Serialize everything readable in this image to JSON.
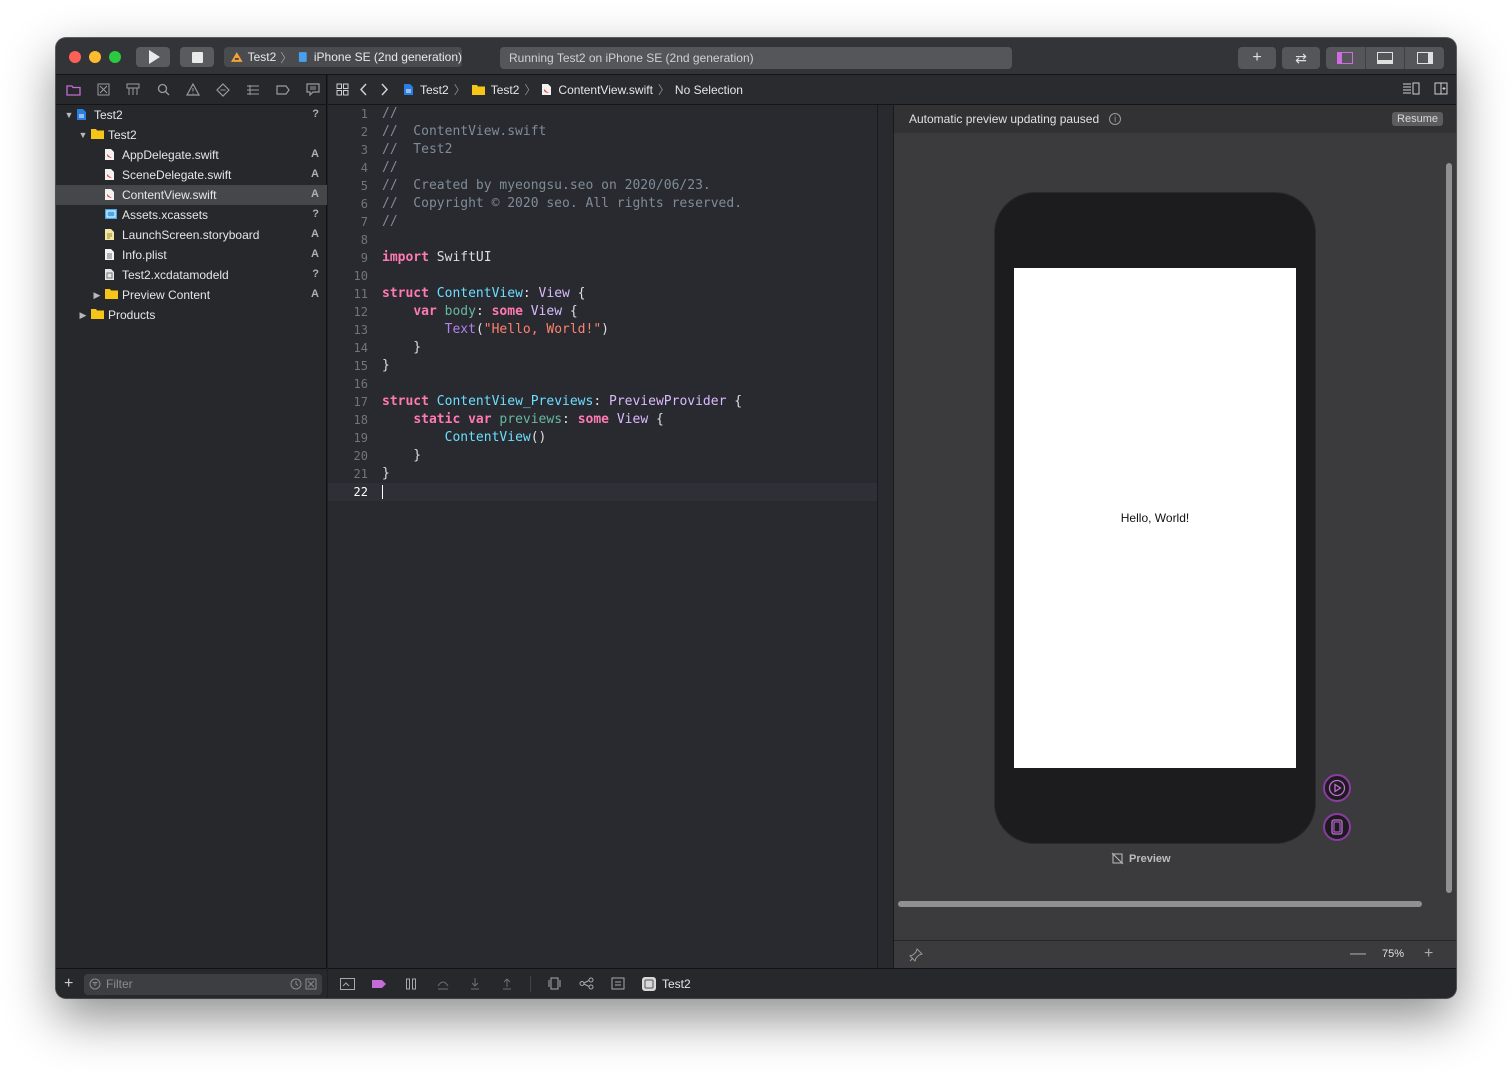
{
  "window": {
    "scheme": {
      "project": "Test2",
      "device": "iPhone SE (2nd generation)"
    },
    "activity_status": "Running Test2 on iPhone SE (2nd generation)",
    "toolbar_add": "+",
    "toolbar_review": "⇄"
  },
  "navigator": {
    "tabs": [
      "folder-icon",
      "source-control-icon",
      "symbol-icon",
      "find-icon",
      "issue-icon",
      "test-icon",
      "debug-icon",
      "breakpoint-icon",
      "report-icon"
    ],
    "tree": [
      {
        "label": "Test2",
        "indent": 0,
        "disclosure": "open",
        "icon": "project-icon",
        "badge": "?"
      },
      {
        "label": "Test2",
        "indent": 1,
        "disclosure": "open",
        "icon": "folder-icon",
        "badge": ""
      },
      {
        "label": "AppDelegate.swift",
        "indent": 2,
        "disclosure": "none",
        "icon": "swift-file-icon",
        "badge": "A"
      },
      {
        "label": "SceneDelegate.swift",
        "indent": 2,
        "disclosure": "none",
        "icon": "swift-file-icon",
        "badge": "A"
      },
      {
        "label": "ContentView.swift",
        "indent": 2,
        "disclosure": "none",
        "icon": "swift-file-icon",
        "badge": "A",
        "selected": true
      },
      {
        "label": "Assets.xcassets",
        "indent": 2,
        "disclosure": "none",
        "icon": "asset-catalog-icon",
        "badge": "?"
      },
      {
        "label": "LaunchScreen.storyboard",
        "indent": 2,
        "disclosure": "none",
        "icon": "storyboard-icon",
        "badge": "A"
      },
      {
        "label": "Info.plist",
        "indent": 2,
        "disclosure": "none",
        "icon": "plist-icon",
        "badge": "A"
      },
      {
        "label": "Test2.xcdatamodeld",
        "indent": 2,
        "disclosure": "none",
        "icon": "datamodel-icon",
        "badge": "?"
      },
      {
        "label": "Preview Content",
        "indent": 2,
        "disclosure": "closed",
        "icon": "folder-icon",
        "badge": "A"
      },
      {
        "label": "Products",
        "indent": 1,
        "disclosure": "closed",
        "icon": "folder-icon",
        "badge": ""
      }
    ],
    "filter_placeholder": "Filter"
  },
  "jumpbar": {
    "crumbs": [
      "Test2",
      "Test2",
      "ContentView.swift",
      "No Selection"
    ]
  },
  "editor": {
    "current_line": 22,
    "lines": [
      [
        [
          "cm",
          "//"
        ]
      ],
      [
        [
          "cm",
          "//  ContentView.swift"
        ]
      ],
      [
        [
          "cm",
          "//  Test2"
        ]
      ],
      [
        [
          "cm",
          "//"
        ]
      ],
      [
        [
          "cm",
          "//  Created by myeongsu.seo on 2020/06/23."
        ]
      ],
      [
        [
          "cm",
          "//  Copyright © 2020 seo. All rights reserved."
        ]
      ],
      [
        [
          "cm",
          "//"
        ]
      ],
      [],
      [
        [
          "kw",
          "import"
        ],
        [
          "pl",
          " SwiftUI"
        ]
      ],
      [],
      [
        [
          "kw",
          "struct"
        ],
        [
          "pl",
          " "
        ],
        [
          "ty",
          "ContentView"
        ],
        [
          "pl",
          ": "
        ],
        [
          "ty2",
          "View"
        ],
        [
          "pl",
          " {"
        ]
      ],
      [
        [
          "pl",
          "    "
        ],
        [
          "kw",
          "var"
        ],
        [
          "pl",
          " "
        ],
        [
          "id",
          "body"
        ],
        [
          "pl",
          ": "
        ],
        [
          "kw",
          "some"
        ],
        [
          "pl",
          " "
        ],
        [
          "ty2",
          "View"
        ],
        [
          "pl",
          " {"
        ]
      ],
      [
        [
          "pl",
          "        "
        ],
        [
          "fn",
          "Text"
        ],
        [
          "pl",
          "("
        ],
        [
          "st",
          "\"Hello, World!\""
        ],
        [
          "pl",
          ")"
        ]
      ],
      [
        [
          "pl",
          "    }"
        ]
      ],
      [
        [
          "pl",
          "}"
        ]
      ],
      [],
      [
        [
          "kw",
          "struct"
        ],
        [
          "pl",
          " "
        ],
        [
          "ty",
          "ContentView_Previews"
        ],
        [
          "pl",
          ": "
        ],
        [
          "ty2",
          "PreviewProvider"
        ],
        [
          "pl",
          " {"
        ]
      ],
      [
        [
          "pl",
          "    "
        ],
        [
          "kw",
          "static"
        ],
        [
          "pl",
          " "
        ],
        [
          "kw",
          "var"
        ],
        [
          "pl",
          " "
        ],
        [
          "id",
          "previews"
        ],
        [
          "pl",
          ": "
        ],
        [
          "kw",
          "some"
        ],
        [
          "pl",
          " "
        ],
        [
          "ty2",
          "View"
        ],
        [
          "pl",
          " {"
        ]
      ],
      [
        [
          "pl",
          "        "
        ],
        [
          "ty",
          "ContentView"
        ],
        [
          "pl",
          "()"
        ]
      ],
      [
        [
          "pl",
          "    }"
        ]
      ],
      [
        [
          "pl",
          "}"
        ]
      ],
      []
    ]
  },
  "canvas": {
    "status": "Automatic preview updating paused",
    "resume_label": "Resume",
    "preview_text": "Hello, World!",
    "preview_label": "Preview",
    "zoom": "75%"
  },
  "debugbar": {
    "target": "Test2"
  },
  "colors": {
    "accent": "#c46bd6",
    "comment": "#7f8c98",
    "keyword": "#ff7ab2",
    "string": "#ff8170",
    "type": "#6bdfff"
  }
}
